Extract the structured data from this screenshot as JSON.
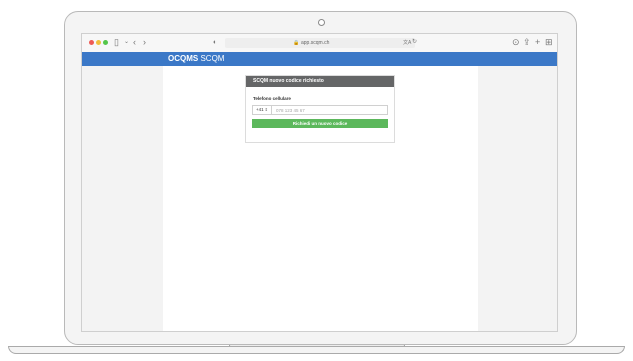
{
  "browser": {
    "url": "app.scqm.ch",
    "translate_icon": "translate-icon",
    "reload_icon": "reload-icon"
  },
  "navbar": {
    "brand_bold": "OCQMS",
    "brand_light": "SCQM"
  },
  "card": {
    "title": "SCQM nuovo codice richiesto",
    "phone_label": "Telefono cellulare",
    "country_code": "+41",
    "phone_placeholder": "078 123 45 67",
    "submit_label": "Richiedi un nuovo codice"
  },
  "colors": {
    "navbar": "#3b78c7",
    "card_header": "#656667",
    "submit": "#5cb85c"
  }
}
